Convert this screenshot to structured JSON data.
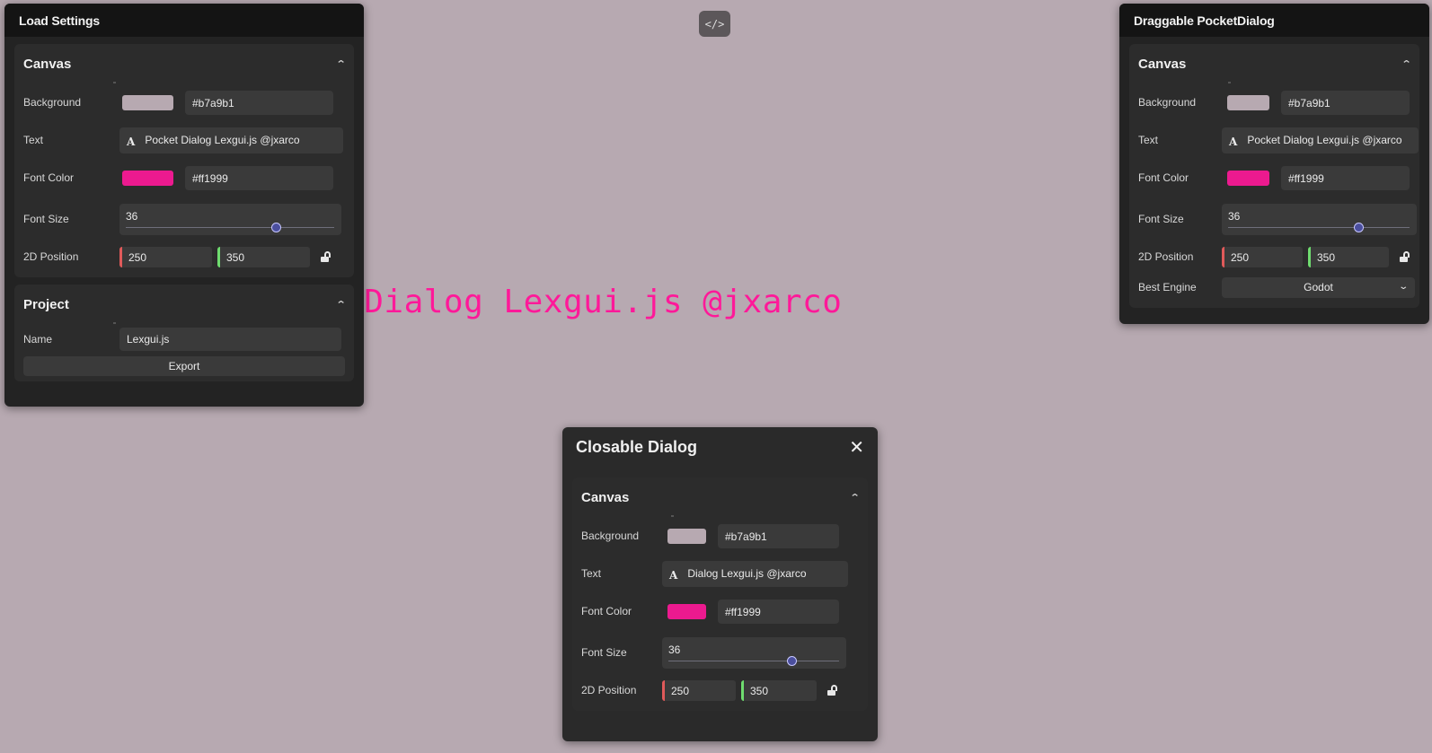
{
  "page": {
    "canvas_text": "Pocket Dialog Lexgui.js @jxarco",
    "canvas_text_color": "#ff1999",
    "background_color": "#b7a9b1",
    "code_button": "</>"
  },
  "load_settings": {
    "title": "Load Settings",
    "canvas": {
      "heading": "Canvas",
      "background_label": "Background",
      "background_value": "#b7a9b1",
      "text_label": "Text",
      "text_value": "Pocket Dialog Lexgui.js @jxarco",
      "font_color_label": "Font Color",
      "font_color_value": "#ff1999",
      "font_size_label": "Font Size",
      "font_size_value": "36",
      "font_size_fraction": 0.72,
      "position_label": "2D Position",
      "pos_x": "250",
      "pos_y": "350"
    },
    "project": {
      "heading": "Project",
      "name_label": "Name",
      "name_value": "Lexgui.js",
      "export_label": "Export"
    }
  },
  "draggable": {
    "title": "Draggable PocketDialog",
    "canvas": {
      "heading": "Canvas",
      "background_label": "Background",
      "background_value": "#b7a9b1",
      "text_label": "Text",
      "text_value": "Pocket Dialog Lexgui.js @jxarco",
      "font_color_label": "Font Color",
      "font_color_value": "#ff1999",
      "font_size_label": "Font Size",
      "font_size_value": "36",
      "font_size_fraction": 0.72,
      "position_label": "2D Position",
      "pos_x": "250",
      "pos_y": "350",
      "engine_label": "Best Engine",
      "engine_value": "Godot"
    }
  },
  "closable": {
    "title": "Closable Dialog",
    "close": "✕",
    "canvas": {
      "heading": "Canvas",
      "background_label": "Background",
      "background_value": "#b7a9b1",
      "text_label": "Text",
      "text_value": "Dialog Lexgui.js @jxarco",
      "font_color_label": "Font Color",
      "font_color_value": "#ff1999",
      "font_size_label": "Font Size",
      "font_size_value": "36",
      "font_size_fraction": 0.72,
      "position_label": "2D Position",
      "pos_x": "250",
      "pos_y": "350"
    }
  },
  "icons": {
    "chevron": "⌃",
    "text_a": "A",
    "dropdown": "⌄"
  },
  "colors": {
    "swatch_bg": "#b7a9b1",
    "swatch_font": "#ec1a8f"
  }
}
